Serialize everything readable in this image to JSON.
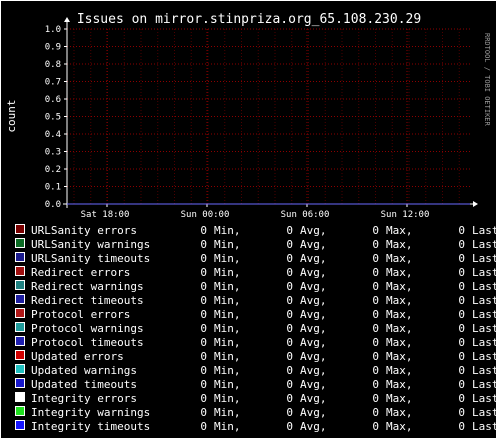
{
  "colors": {
    "background": "#000000",
    "text": "#ffffff",
    "grid": "#8b0000",
    "axis": "#ffffff",
    "series_line": "#6a6aff"
  },
  "watermark": "RRDTOOL / TOBI OETIKER",
  "chart_data": {
    "type": "line",
    "title": "Issues on mirror.stinpriza.org_65.108.230.29",
    "ylabel": "count",
    "xlabel": "",
    "ylim": [
      0,
      1
    ],
    "y_ticks": [
      "0.0",
      "0.1",
      "0.2",
      "0.3",
      "0.4",
      "0.5",
      "0.6",
      "0.7",
      "0.8",
      "0.9",
      "1.0"
    ],
    "x_ticks": [
      "Sat 18:00",
      "Sun 00:00",
      "Sun 06:00",
      "Sun 12:00"
    ],
    "grid": true,
    "legend_position": "bottom",
    "legend_columns": [
      "Min,",
      "Avg,",
      "Max,",
      "Last"
    ],
    "series": [
      {
        "name": "URLSanity errors",
        "color": "#7a0000",
        "min": "0",
        "avg": "0",
        "max": "0",
        "last": "0",
        "values": [
          0,
          0
        ]
      },
      {
        "name": "URLSanity warnings",
        "color": "#0b6b24",
        "min": "0",
        "avg": "0",
        "max": "0",
        "last": "0",
        "values": [
          0,
          0
        ]
      },
      {
        "name": "URLSanity timeouts",
        "color": "#1a1a8c",
        "min": "0",
        "avg": "0",
        "max": "0",
        "last": "0",
        "values": [
          0,
          0
        ]
      },
      {
        "name": "Redirect errors",
        "color": "#a01010",
        "min": "0",
        "avg": "0",
        "max": "0",
        "last": "0",
        "values": [
          0,
          0
        ]
      },
      {
        "name": "Redirect warnings",
        "color": "#1f8080",
        "min": "0",
        "avg": "0",
        "max": "0",
        "last": "0",
        "values": [
          0,
          0
        ]
      },
      {
        "name": "Redirect timeouts",
        "color": "#1f1fa0",
        "min": "0",
        "avg": "0",
        "max": "0",
        "last": "0",
        "values": [
          0,
          0
        ]
      },
      {
        "name": "Protocol errors",
        "color": "#b01818",
        "min": "0",
        "avg": "0",
        "max": "0",
        "last": "0",
        "values": [
          0,
          0
        ]
      },
      {
        "name": "Protocol warnings",
        "color": "#209c9c",
        "min": "0",
        "avg": "0",
        "max": "0",
        "last": "0",
        "values": [
          0,
          0
        ]
      },
      {
        "name": "Protocol timeouts",
        "color": "#2020b0",
        "min": "0",
        "avg": "0",
        "max": "0",
        "last": "0",
        "values": [
          0,
          0
        ]
      },
      {
        "name": "Updated errors",
        "color": "#d00000",
        "min": "0",
        "avg": "0",
        "max": "0",
        "last": "0",
        "values": [
          0,
          0
        ]
      },
      {
        "name": "Updated warnings",
        "color": "#20c0c0",
        "min": "0",
        "avg": "0",
        "max": "0",
        "last": "0",
        "values": [
          0,
          0
        ]
      },
      {
        "name": "Updated timeouts",
        "color": "#1818cc",
        "min": "0",
        "avg": "0",
        "max": "0",
        "last": "0",
        "values": [
          0,
          0
        ]
      },
      {
        "name": "Integrity errors",
        "color": "#ffffff",
        "min": "0",
        "avg": "0",
        "max": "0",
        "last": "0",
        "values": [
          0,
          0
        ]
      },
      {
        "name": "Integrity warnings",
        "color": "#20e020",
        "min": "0",
        "avg": "0",
        "max": "0",
        "last": "0",
        "values": [
          0,
          0
        ]
      },
      {
        "name": "Integrity timeouts",
        "color": "#1515ff",
        "min": "0",
        "avg": "0",
        "max": "0",
        "last": "0",
        "values": [
          0,
          0
        ]
      }
    ]
  }
}
